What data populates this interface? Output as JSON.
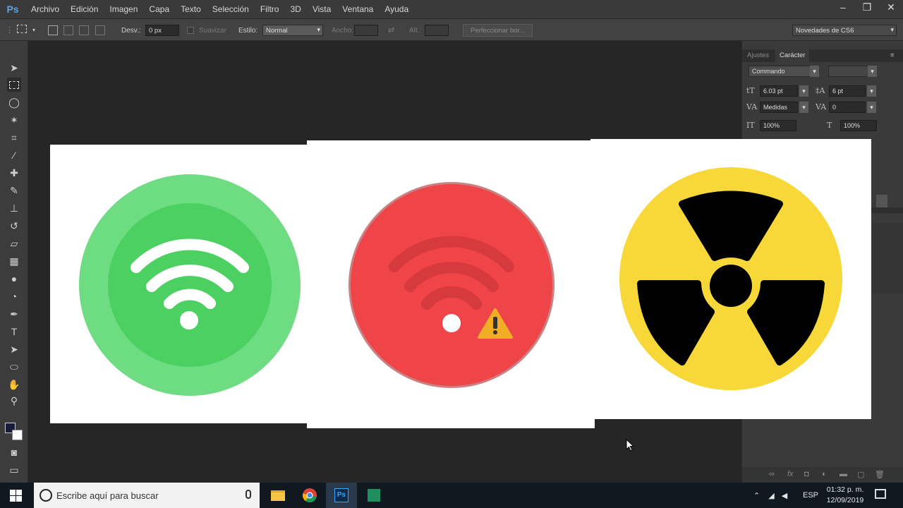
{
  "app": {
    "logo": "Ps",
    "menu": [
      "Archivo",
      "Edición",
      "Imagen",
      "Capa",
      "Texto",
      "Selección",
      "Filtro",
      "3D",
      "Vista",
      "Ventana",
      "Ayuda"
    ]
  },
  "options": {
    "desv_label": "Desv.:",
    "desv_value": "0 px",
    "suavizar": "Suavizar",
    "estilo_label": "Estilo:",
    "estilo_value": "Normal",
    "ancho": "Ancho:",
    "alto": "Alt.:",
    "refine_button": "Perfeccionar bor...",
    "workspace": "Novedades de CS6"
  },
  "panel": {
    "tabs": [
      "Ajustes",
      "Carácter"
    ],
    "font_family": "Commando",
    "font_size": "6.03 pt",
    "leading": "6 pt",
    "kerning": "Medidas",
    "tracking": "0",
    "vscale": "100%",
    "hscale": "100%"
  },
  "taskbar": {
    "search_placeholder": "Escribe aquí para buscar",
    "lang": "ESP",
    "time": "01:32 p. m.",
    "date": "12/09/2019"
  },
  "colors": {
    "wifi_ok": "#4cd062",
    "wifi_error": "#ef4448",
    "radiation": "#f7d838"
  }
}
